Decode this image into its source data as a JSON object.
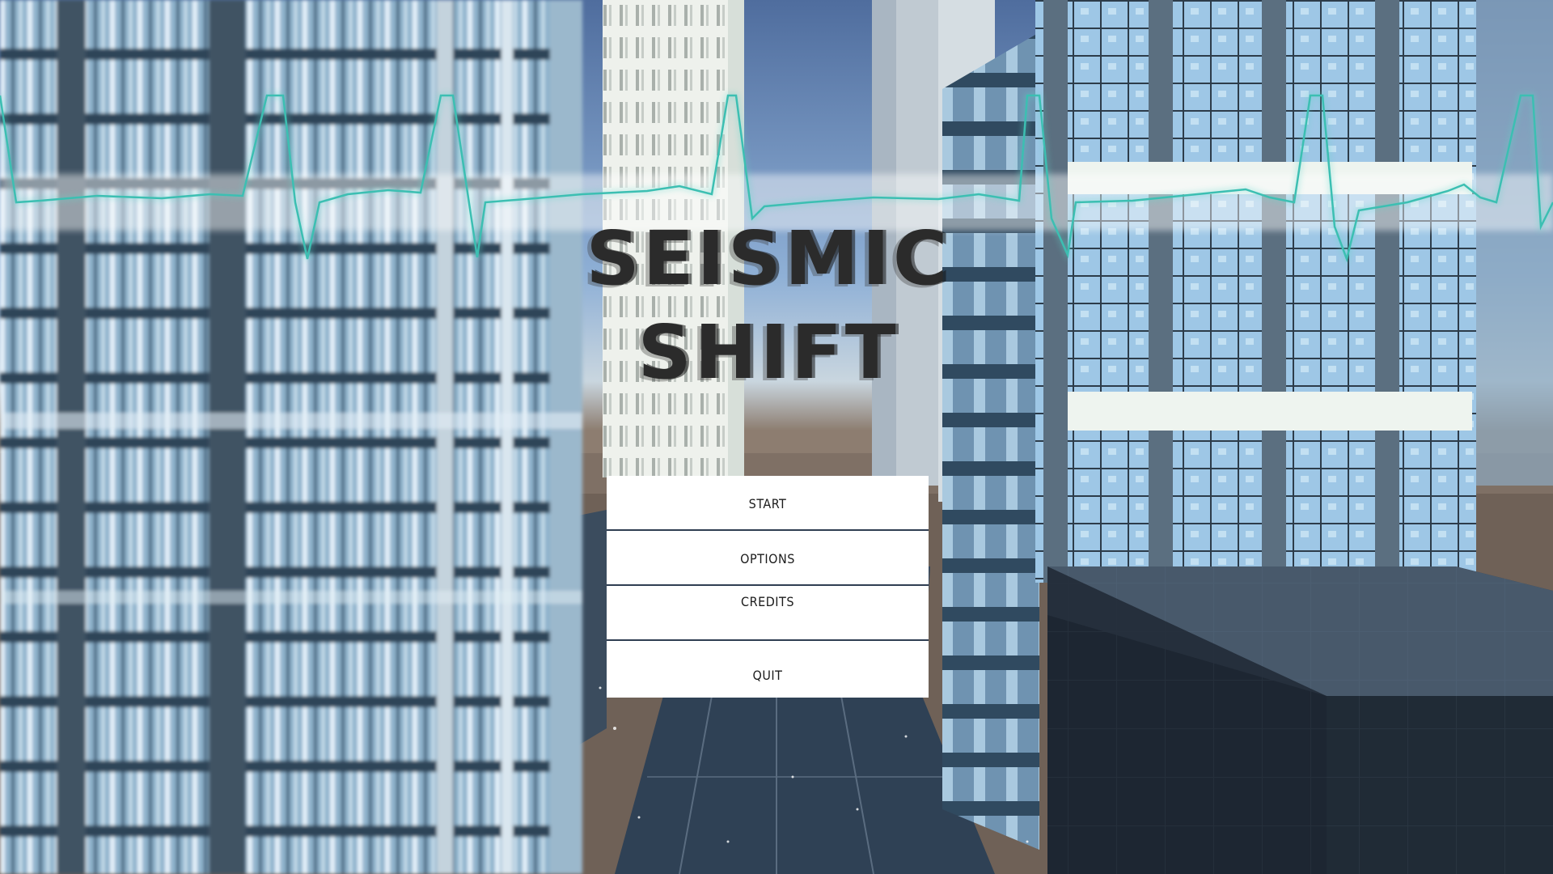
{
  "game": {
    "title_line1": "SEISMIC",
    "title_line2": "SHIFT"
  },
  "menu": {
    "start_label": "START",
    "options_label": "OPTIONS",
    "credits_label": "CREDITS",
    "quit_label": "QUIT"
  },
  "colors": {
    "title": "#2b2b2b",
    "ekg_line": "#5fd6c9",
    "button_bg": "#ffffff",
    "button_divider": "#2f3e52",
    "sky": "#7f9fc4",
    "ground": "#6f6157",
    "street": "#2f4155"
  }
}
